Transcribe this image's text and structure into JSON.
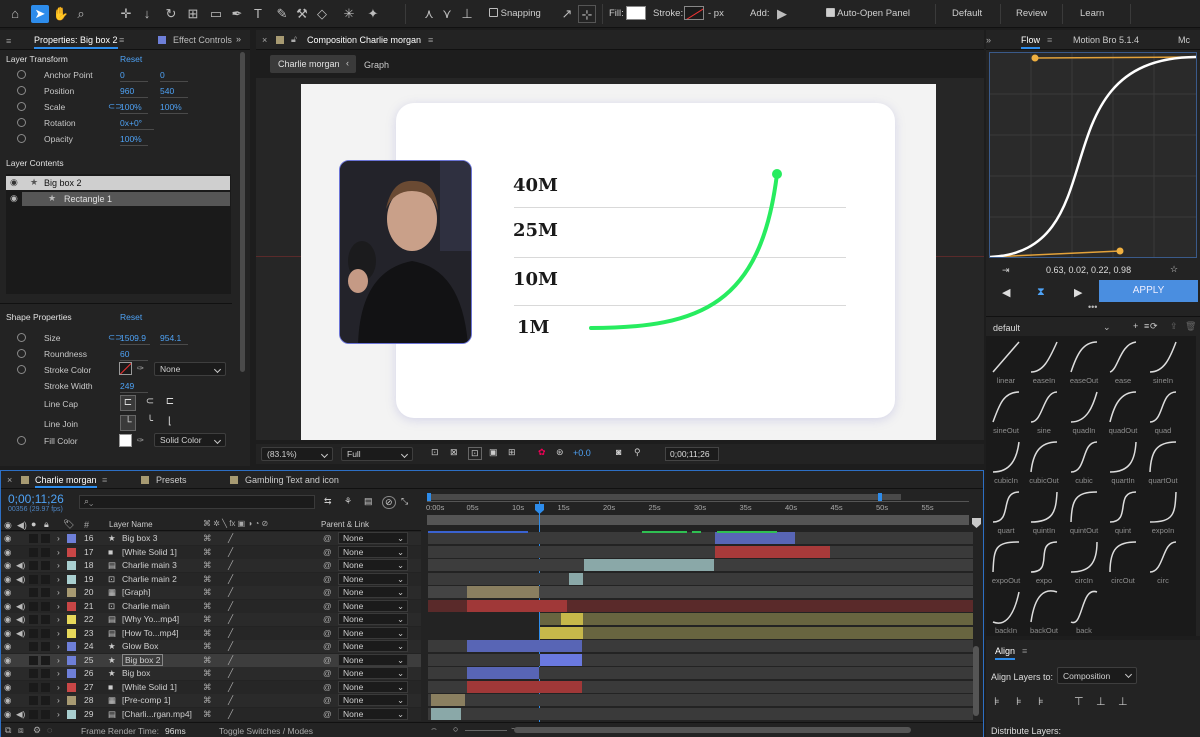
{
  "toolbar": {
    "snapping": "Snapping",
    "fill": "Fill:",
    "stroke": "Stroke:",
    "stroke_px": "- px",
    "add": "Add:",
    "auto_open": "Auto-Open Panel",
    "workspaces": [
      "Default",
      "Review",
      "Learn"
    ]
  },
  "properties": {
    "tab": "Properties: Big box 2",
    "tab2": "Effect Controls",
    "layer_transform": "Layer Transform",
    "reset": "Reset",
    "anchor_label": "Anchor Point",
    "anchor_x": "0",
    "anchor_y": "0",
    "position_label": "Position",
    "position_x": "960",
    "position_y": "540",
    "scale_label": "Scale",
    "scale_x": "100%",
    "scale_y": "100%",
    "rotation_label": "Rotation",
    "rotation": "0x+0°",
    "opacity_label": "Opacity",
    "opacity": "100%",
    "layer_contents": "Layer Contents",
    "contents": [
      "Big box 2",
      "Rectangle 1"
    ],
    "shape_props": "Shape Properties",
    "size_label": "Size",
    "size_w": "1509.9",
    "size_h": "954.1",
    "roundness_label": "Roundness",
    "roundness": "60",
    "stroke_color_label": "Stroke Color",
    "stroke_mode": "None",
    "stroke_width_label": "Stroke Width",
    "stroke_width": "249",
    "line_cap_label": "Line Cap",
    "line_join_label": "Line Join",
    "fill_color_label": "Fill Color",
    "fill_mode": "Solid Color"
  },
  "composition": {
    "tab": "Composition Charlie morgan",
    "crumb1": "Charlie morgan",
    "crumb2": "Graph",
    "labels": [
      "40M",
      "25M",
      "10M",
      "1M"
    ],
    "zoom": "(83.1%)",
    "quality": "Full",
    "exposure": "+0.0",
    "timecode": "0;00;11;26"
  },
  "flow": {
    "tabs": [
      "Flow",
      "Motion Bro 5.1.4",
      "Mc"
    ],
    "values": "0.63, 0.02, 0.22, 0.98",
    "apply": "APPLY",
    "preset_group": "default",
    "presets": [
      "linear",
      "easeIn",
      "easeOut",
      "ease",
      "sineIn",
      "sineOut",
      "sine",
      "quadIn",
      "quadOut",
      "quad",
      "cubicIn",
      "cubicOut",
      "cubic",
      "quartIn",
      "quartOut",
      "quart",
      "quintIn",
      "quintOut",
      "quint",
      "expoIn",
      "expoOut",
      "expo",
      "circIn",
      "circOut",
      "circ",
      "backIn",
      "backOut",
      "back"
    ]
  },
  "align": {
    "title": "Align",
    "align_to_label": "Align Layers to:",
    "align_to": "Composition",
    "distribute": "Distribute Layers:"
  },
  "timeline": {
    "tabs": [
      "Charlie morgan",
      "Presets",
      "Gambling Text and icon"
    ],
    "timecode": "0;00;11;26",
    "frames": "00356 (29.97 fps)",
    "col_name": "Layer Name",
    "col_parent": "Parent & Link",
    "ticks": [
      "0:00s",
      "05s",
      "10s",
      "15s",
      "20s",
      "25s",
      "30s",
      "35s",
      "40s",
      "45s",
      "50s",
      "55s"
    ],
    "layers": [
      {
        "num": "16",
        "name": "Big box 3",
        "color": "#6e7fd8"
      },
      {
        "num": "17",
        "name": "[White Solid 1]",
        "color": "#c84646"
      },
      {
        "num": "18",
        "name": "Charlie main 3",
        "color": "#a9cfd0"
      },
      {
        "num": "19",
        "name": "Charlie main 2",
        "color": "#a9cfd0"
      },
      {
        "num": "20",
        "name": "[Graph]",
        "color": "#a79a72"
      },
      {
        "num": "21",
        "name": "Charlie main",
        "color": "#c84646"
      },
      {
        "num": "22",
        "name": "[Why Yo...mp4]",
        "color": "#e6d85a"
      },
      {
        "num": "23",
        "name": "[How To...mp4]",
        "color": "#e6d85a"
      },
      {
        "num": "24",
        "name": "Glow Box",
        "color": "#6e7fd8"
      },
      {
        "num": "25",
        "name": "Big box 2",
        "color": "#6e7fd8"
      },
      {
        "num": "26",
        "name": "Big box",
        "color": "#6e7fd8"
      },
      {
        "num": "27",
        "name": "[White Solid 1]",
        "color": "#c84646"
      },
      {
        "num": "28",
        "name": "[Pre-comp 1]",
        "color": "#a79a72"
      },
      {
        "num": "29",
        "name": "[Charli...rgan.mp4]",
        "color": "#a9cfd0"
      }
    ],
    "parent_none": "None",
    "render_time_label": "Frame Render Time:",
    "render_time": "96ms",
    "toggle": "Toggle Switches / Modes"
  }
}
